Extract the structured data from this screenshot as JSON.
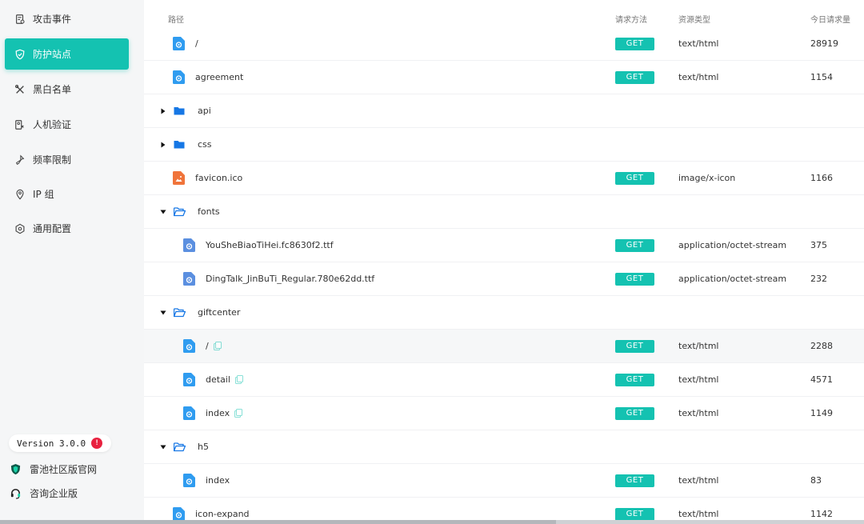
{
  "sidebar": {
    "items": [
      {
        "label": "攻击事件",
        "icon": "attack-log-icon"
      },
      {
        "label": "防护站点",
        "icon": "shield-icon"
      },
      {
        "label": "黑白名单",
        "icon": "tools-icon"
      },
      {
        "label": "人机验证",
        "icon": "captcha-icon"
      },
      {
        "label": "频率限制",
        "icon": "rate-limit-icon"
      },
      {
        "label": "IP 组",
        "icon": "location-icon"
      },
      {
        "label": "通用配置",
        "icon": "settings-icon"
      }
    ],
    "active_index": 1,
    "version": "Version 3.0.0",
    "version_badge": "!",
    "links": [
      {
        "label": "雷池社区版官网",
        "icon": "safeline-shield-icon"
      },
      {
        "label": "咨询企业版",
        "icon": "headset-icon"
      }
    ]
  },
  "table": {
    "headers": {
      "path": "路径",
      "method": "请求方法",
      "type": "资源类型",
      "count": "今日请求量"
    },
    "rows": [
      {
        "depth": 0,
        "kind": "file",
        "icon": "html-file-icon",
        "name": "/",
        "method": "GET",
        "type": "text/html",
        "count": "28919"
      },
      {
        "depth": 0,
        "kind": "file",
        "icon": "html-file-icon",
        "name": "agreement",
        "method": "GET",
        "type": "text/html",
        "count": "1154"
      },
      {
        "depth": 0,
        "kind": "folder",
        "expanded": false,
        "icon": "folder-icon",
        "name": "api"
      },
      {
        "depth": 0,
        "kind": "folder",
        "expanded": false,
        "icon": "folder-icon",
        "name": "css"
      },
      {
        "depth": 0,
        "kind": "file",
        "icon": "image-file-icon",
        "name": "favicon.ico",
        "method": "GET",
        "type": "image/x-icon",
        "count": "1166"
      },
      {
        "depth": 0,
        "kind": "folder",
        "expanded": true,
        "icon": "folder-open-icon",
        "name": "fonts"
      },
      {
        "depth": 1,
        "kind": "file",
        "icon": "font-file-icon",
        "name": "YouSheBiaoTiHei.fc8630f2.ttf",
        "method": "GET",
        "type": "application/octet-stream",
        "count": "375"
      },
      {
        "depth": 1,
        "kind": "file",
        "icon": "font-file-icon",
        "name": "DingTalk_JinBuTi_Regular.780e62dd.ttf",
        "method": "GET",
        "type": "application/octet-stream",
        "count": "232"
      },
      {
        "depth": 0,
        "kind": "folder",
        "expanded": true,
        "icon": "folder-open-icon",
        "name": "giftcenter"
      },
      {
        "depth": 1,
        "kind": "file",
        "icon": "html-file-icon",
        "name": "/",
        "copy": true,
        "method": "GET",
        "type": "text/html",
        "count": "2288",
        "highlight": true
      },
      {
        "depth": 1,
        "kind": "file",
        "icon": "html-file-icon",
        "name": "detail",
        "copy": true,
        "method": "GET",
        "type": "text/html",
        "count": "4571"
      },
      {
        "depth": 1,
        "kind": "file",
        "icon": "html-file-icon",
        "name": "index",
        "copy": true,
        "method": "GET",
        "type": "text/html",
        "count": "1149"
      },
      {
        "depth": 0,
        "kind": "folder",
        "expanded": true,
        "icon": "folder-open-icon",
        "name": "h5"
      },
      {
        "depth": 1,
        "kind": "file",
        "icon": "html-file-icon",
        "name": "index",
        "method": "GET",
        "type": "text/html",
        "count": "83"
      },
      {
        "depth": 0,
        "kind": "file",
        "icon": "html-file-icon",
        "name": "icon-expand",
        "method": "GET",
        "type": "text/html",
        "count": "1142"
      }
    ]
  },
  "colors": {
    "accent": "#14c2b1",
    "folder": "#1677e5",
    "html_file": "#2f9cf0",
    "image_file": "#f0743a",
    "font_file": "#5b8fe0",
    "badge": "#e8213f"
  }
}
